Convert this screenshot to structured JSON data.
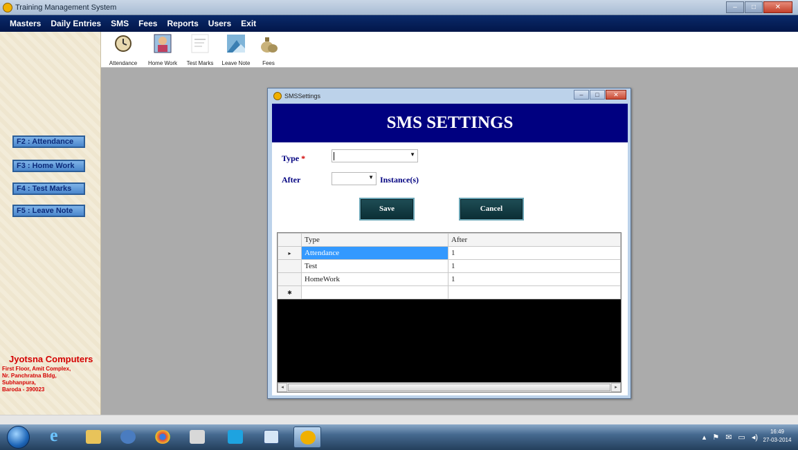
{
  "window": {
    "title": "Training Management System",
    "controls": [
      "–",
      "□",
      "✕"
    ]
  },
  "menu": [
    "Masters",
    "Daily Entries",
    "SMS",
    "Fees",
    "Reports",
    "Users",
    "Exit"
  ],
  "toolbar": {
    "items": [
      {
        "label": "Attendance",
        "icon": "clock-icon"
      },
      {
        "label": "Home Work",
        "icon": "student-icon"
      },
      {
        "label": "Test Marks",
        "icon": "document-icon"
      },
      {
        "label": "Leave Note",
        "icon": "note-icon"
      },
      {
        "label": "Fees",
        "icon": "money-bag-icon"
      }
    ]
  },
  "sidebar": {
    "keys": [
      "F2 : Attendance",
      "F3 : Home Work",
      "F4 : Test Marks",
      "F5 : Leave Note"
    ],
    "company": {
      "name": "Jyotsna Computers",
      "lines": [
        "First Floor, Amit Complex,",
        "Nr. Panchratna Bldg,",
        "Subhanpura,",
        "Baroda - 390023"
      ]
    }
  },
  "dialog": {
    "title": "SMSSettings",
    "heading": "SMS SETTINGS",
    "type_label": "Type",
    "required_mark": "*",
    "type_value": "",
    "after_label": "After",
    "after_value": "",
    "instances_label": "Instance(s)",
    "save_label": "Save",
    "cancel_label": "Cancel",
    "grid": {
      "columns": [
        "Type",
        "After"
      ],
      "rows": [
        {
          "marker": "▸",
          "type": "Attendance",
          "after": "1",
          "selected": true
        },
        {
          "marker": "",
          "type": "Test",
          "after": "1"
        },
        {
          "marker": "",
          "type": "HomeWork",
          "after": "1"
        },
        {
          "marker": "✱",
          "type": "",
          "after": ""
        }
      ],
      "scroll_left": "◂",
      "scroll_right": "▸"
    }
  },
  "taskbar": {
    "apps": [
      "start",
      "internet-explorer",
      "file-explorer",
      "media-player",
      "chrome",
      "paint",
      "skype",
      "notepad",
      "training-app"
    ],
    "tray_icons": [
      "▴",
      "⚑",
      "✉",
      "▭",
      "◂)"
    ],
    "time": "16:49",
    "date": "27-03-2014"
  },
  "colors": {
    "banner": "#000080",
    "menubar": "#02164a",
    "mdi": "#ababab",
    "selected_row": "#3399ff",
    "company_text": "#d40000"
  }
}
